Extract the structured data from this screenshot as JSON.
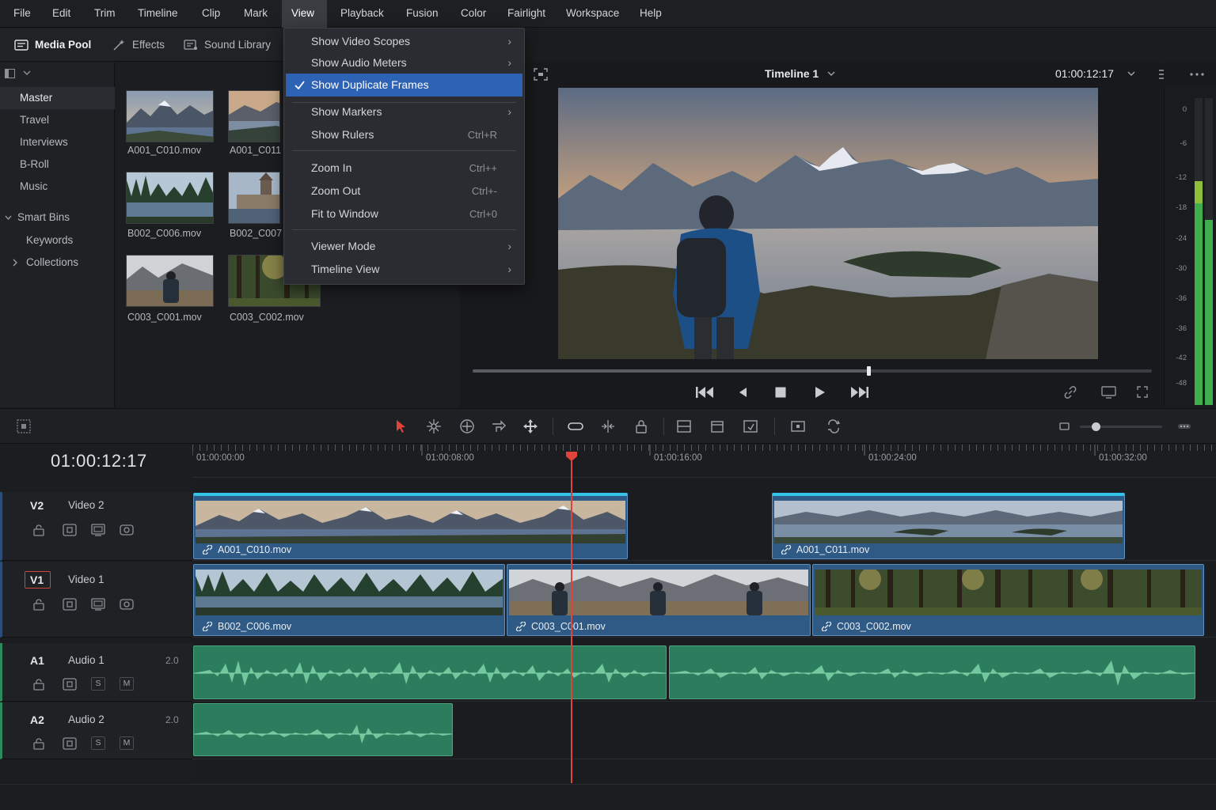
{
  "menubar": {
    "items": [
      "File",
      "Edit",
      "Trim",
      "Timeline",
      "Clip",
      "Mark",
      "View",
      "Playback",
      "Fusion",
      "Color",
      "Fairlight",
      "Workspace",
      "Help"
    ],
    "active": "View"
  },
  "toolbar": {
    "media_pool": "Media Pool",
    "effects": "Effects",
    "sound_library": "Sound Library"
  },
  "bins": {
    "items": [
      "Master",
      "Travel",
      "Interviews",
      "B-Roll",
      "Music"
    ],
    "smart_bins": "Smart Bins",
    "keywords": "Keywords",
    "collections": "Collections"
  },
  "media_pool": {
    "clips": [
      "A001_C010.mov",
      "A001_C011.",
      "B002_C006.mov",
      "B002_C007.",
      "C003_C001.mov",
      "C003_C002.mov"
    ]
  },
  "view_menu": {
    "items": [
      {
        "label": "Show Video Scopes",
        "shortcut": "",
        "submenu": true,
        "checked": false
      },
      {
        "label": "Show Audio Meters",
        "shortcut": "",
        "submenu": true,
        "checked": false
      },
      {
        "label": "Show Duplicate Frames",
        "shortcut": "",
        "submenu": false,
        "checked": true
      },
      {
        "label": "Show Markers",
        "shortcut": "",
        "submenu": true,
        "checked": false
      },
      {
        "label": "Show Rulers",
        "shortcut": "Ctrl+R",
        "submenu": false,
        "checked": false
      },
      {
        "label": "Zoom In",
        "shortcut": "Ctrl++",
        "submenu": false,
        "checked": false
      },
      {
        "label": "Zoom Out",
        "shortcut": "Ctrl+-",
        "submenu": false,
        "checked": false
      },
      {
        "label": "Fit to Window",
        "shortcut": "Ctrl+0",
        "submenu": false,
        "checked": false
      },
      {
        "label": "Viewer Mode",
        "shortcut": "",
        "submenu": true,
        "checked": false
      },
      {
        "label": "Timeline View",
        "shortcut": "",
        "submenu": true,
        "checked": false
      }
    ],
    "highlighted": "Show Duplicate Frames"
  },
  "viewer": {
    "timeline_name": "Timeline 1",
    "timecode": "01:00:12:17",
    "scrub_position": 0.58
  },
  "meters": {
    "labels": [
      "0",
      "-6",
      "-12",
      "-18",
      "-24",
      "-30",
      "-36",
      "-36",
      "-42",
      "-48"
    ]
  },
  "timeline": {
    "timecode": "01:00:12:17",
    "ruler_labels": [
      "01:00:00:00",
      "01:00:08:00",
      "01:00:16:00",
      "01:00:24:00",
      "01:00:32:00"
    ],
    "tracks": [
      {
        "id": "V2",
        "name": "Video 2",
        "volume": ""
      },
      {
        "id": "V1",
        "name": "Video 1",
        "volume": ""
      },
      {
        "id": "A1",
        "name": "Audio 1",
        "volume": "2.0"
      },
      {
        "id": "A2",
        "name": "Audio 2",
        "volume": "2.0"
      }
    ],
    "clips": {
      "v2": [
        "A001_C010.mov",
        "A001_C011.mov"
      ],
      "v1": [
        "B002_C006.mov",
        "C003_C001.mov",
        "C003_C002.mov"
      ]
    },
    "solo": "S",
    "mute": "M"
  },
  "colors": {
    "accent": "#2e62b5",
    "playhead": "#e0433a",
    "video_clip": "#2f5a86",
    "audio_clip": "#2c7d5d",
    "meter_green": "#3fae4f"
  }
}
